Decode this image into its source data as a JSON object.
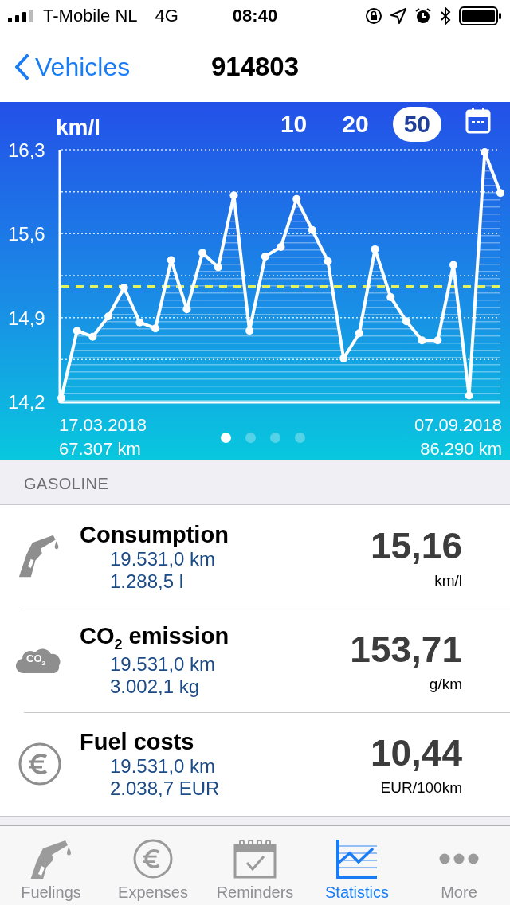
{
  "status_bar": {
    "carrier": "T-Mobile NL",
    "network": "4G",
    "time": "08:40"
  },
  "nav": {
    "back": "Vehicles",
    "title": "914803"
  },
  "chart_panel": {
    "periods": [
      {
        "label": "10",
        "selected": false
      },
      {
        "label": "20",
        "selected": false
      },
      {
        "label": "50",
        "selected": true
      }
    ],
    "chart_data": {
      "type": "area",
      "ylabel": "km/l",
      "ylim": [
        14.2,
        16.3
      ],
      "yticks": [
        {
          "value": 14.2,
          "label": "14,2"
        },
        {
          "value": 14.9,
          "label": "14,9"
        },
        {
          "value": 15.6,
          "label": "15,6"
        },
        {
          "value": 16.3,
          "label": "16,3"
        }
      ],
      "series": [
        {
          "color": "#ffffff",
          "marker": true,
          "values": [
            14.23,
            14.79,
            14.74,
            14.91,
            15.15,
            14.86,
            14.81,
            15.38,
            14.97,
            15.44,
            15.32,
            15.92,
            14.79,
            15.41,
            15.49,
            15.89,
            15.63,
            15.37,
            14.56,
            14.77,
            15.47,
            15.07,
            14.87,
            14.71,
            14.71,
            15.34,
            14.25,
            16.28,
            15.94
          ]
        }
      ],
      "ref_lines": [
        {
          "axis": "y",
          "value": 15.16,
          "color": "#e6f25a"
        }
      ]
    },
    "start_date": "17.03.2018",
    "start_km": "67.307 km",
    "end_date": "07.09.2018",
    "end_km": "86.290 km",
    "pages": [
      {
        "selected": true
      },
      {
        "selected": false
      },
      {
        "selected": false
      },
      {
        "selected": false
      }
    ]
  },
  "section": {
    "title": "GASOLINE"
  },
  "stats": [
    {
      "kind": "pump",
      "title": "Consumption",
      "line_1": "19.531,0 km",
      "line_2": "1.288,5 l",
      "value": "15,16",
      "unit": "km/l"
    },
    {
      "kind": "cloud",
      "icon_text": "CO$_{2}$",
      "title": "CO$_{2}$ emission",
      "line_1": "19.531,0 km",
      "line_2": "3.002,1 kg",
      "value": "153,71",
      "unit": "g/km"
    },
    {
      "kind": "euro",
      "title": "Fuel costs",
      "line_1": "19.531,0 km",
      "line_2": "2.038,7 EUR",
      "value": "10,44",
      "unit": "EUR/100km"
    }
  ],
  "tab_bar": [
    {
      "kind": "pump",
      "label": "Fuelings",
      "selected": false
    },
    {
      "kind": "euro",
      "label": "Expenses",
      "selected": false
    },
    {
      "kind": "calendar",
      "label": "Reminders",
      "selected": false
    },
    {
      "kind": "chart",
      "label": "Statistics",
      "selected": true
    },
    {
      "kind": "more",
      "label": "More",
      "selected": false
    }
  ]
}
